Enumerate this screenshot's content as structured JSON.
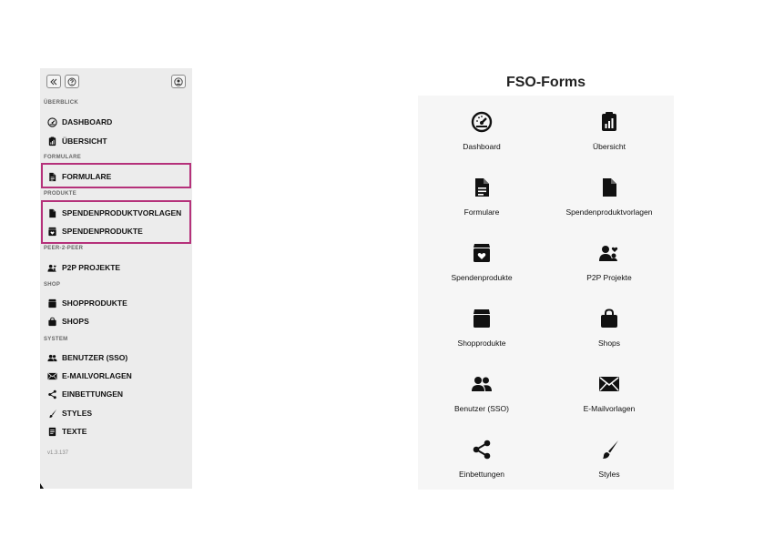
{
  "sidebar": {
    "sections": {
      "overview": "ÜBERBLICK",
      "forms": "FORMULARE",
      "products": "PRODUKTE",
      "p2p": "PEER-2-PEER",
      "shop": "SHOP",
      "system": "SYSTEM"
    },
    "items": {
      "dashboard": "DASHBOARD",
      "uebersicht": "ÜBERSICHT",
      "formulare": "FORMULARE",
      "vorlagen": "SPENDENPRODUKTVORLAGEN",
      "spendenprodukte": "SPENDENPRODUKTE",
      "p2p": "P2P PROJEKTE",
      "shopprodukte": "SHOPPRODUKTE",
      "shops": "SHOPS",
      "benutzer": "BENUTZER (SSO)",
      "mailvorlagen": "E-MAILVORLAGEN",
      "einbettungen": "EINBETTUNGEN",
      "styles": "STYLES",
      "texte": "TEXTE"
    },
    "version": "v1.3.137",
    "highlight_color": "#b5317a"
  },
  "main": {
    "title": "FSO-Forms",
    "tiles": {
      "dashboard": "Dashboard",
      "uebersicht": "Übersicht",
      "formulare": "Formulare",
      "vorlagen": "Spendenproduktvorlagen",
      "spendenprodukte": "Spendenprodukte",
      "p2p": "P2P Projekte",
      "shopprodukte": "Shopprodukte",
      "shops": "Shops",
      "benutzer": "Benutzer (SSO)",
      "mailvorlagen": "E-Mailvorlagen",
      "einbettungen": "Einbettungen",
      "styles": "Styles"
    }
  },
  "icons": {
    "collapse": "double-chevron-left-icon",
    "help": "help-icon",
    "account": "user-circle-icon",
    "dashboard": "gauge-icon",
    "uebersicht": "clipboard-chart-icon",
    "formulare": "file-text-icon",
    "vorlagen": "file-icon",
    "spendenprodukte": "box-heart-icon",
    "p2p": "people-heart-icon",
    "shopprodukte": "box-icon",
    "shops": "shopping-bag-icon",
    "benutzer": "users-icon",
    "mailvorlagen": "envelope-icon",
    "einbettungen": "share-icon",
    "styles": "brush-icon",
    "texte": "text-document-icon"
  }
}
